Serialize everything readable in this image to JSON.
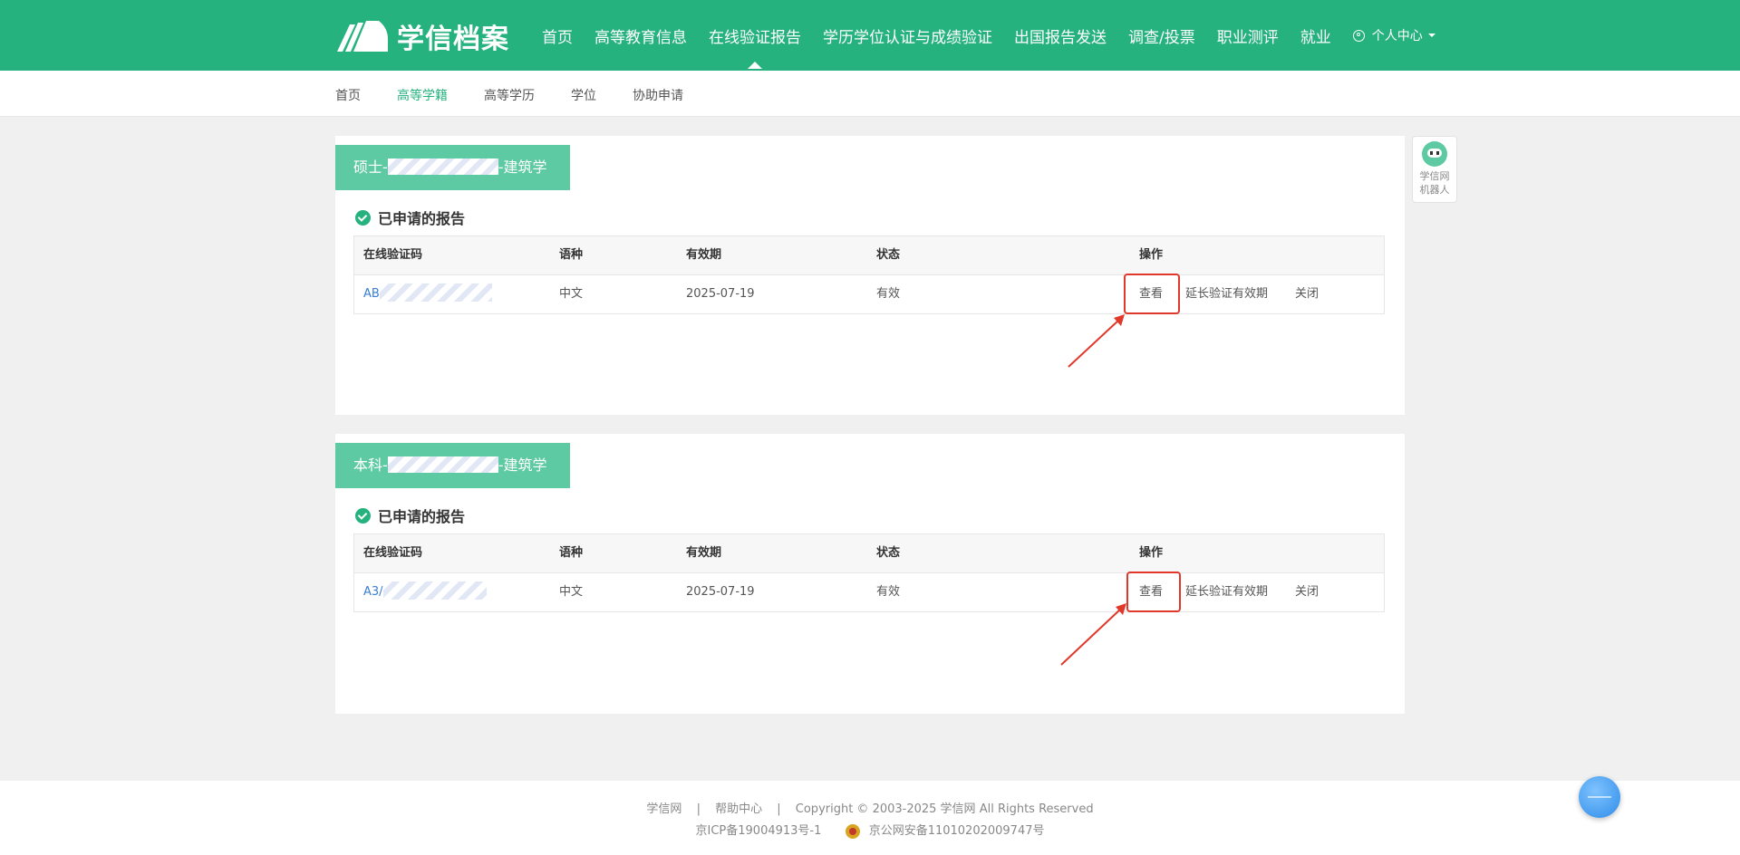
{
  "brand": {
    "title": "学信档案"
  },
  "topnav": {
    "items": [
      "首页",
      "高等教育信息",
      "在线验证报告",
      "学历学位认证与成绩验证",
      "出国报告发送",
      "调查/投票",
      "职业测评",
      "就业"
    ],
    "user_center": "个人中心"
  },
  "subnav": {
    "items": [
      "首页",
      "高等学籍",
      "高等学历",
      "学位",
      "协助申请"
    ]
  },
  "cards": [
    {
      "title_prefix": "硕士-",
      "title_suffix": "-建筑学",
      "section": "已申请的报告",
      "headers": [
        "在线验证码",
        "语种",
        "有效期",
        "状态",
        "操作"
      ],
      "row": {
        "code": "AB",
        "lang": "中文",
        "expiry": "2025-07-19",
        "status": "有效",
        "view": "查看",
        "extend": "延长验证有效期",
        "close": "关闭"
      }
    },
    {
      "title_prefix": "本科-",
      "title_suffix": "-建筑学",
      "section": "已申请的报告",
      "headers": [
        "在线验证码",
        "语种",
        "有效期",
        "状态",
        "操作"
      ],
      "row": {
        "code": "A3/",
        "lang": "中文",
        "expiry": "2025-07-19",
        "status": "有效",
        "view": "查看",
        "extend": "延长验证有效期",
        "close": "关闭"
      }
    }
  ],
  "robot": {
    "line1": "学信网",
    "line2": "机器人"
  },
  "footer": {
    "links": [
      "学信网",
      "帮助中心"
    ],
    "copyright": "Copyright © 2003-2025 学信网 All Rights Reserved",
    "icp": "京ICP备19004913号-1",
    "police": "京公网安备11010202009747号"
  },
  "colors": {
    "brand": "#25b27f",
    "card_title": "#5ecaa3",
    "link": "#3a7ed6",
    "annotation": "#e0382a"
  }
}
